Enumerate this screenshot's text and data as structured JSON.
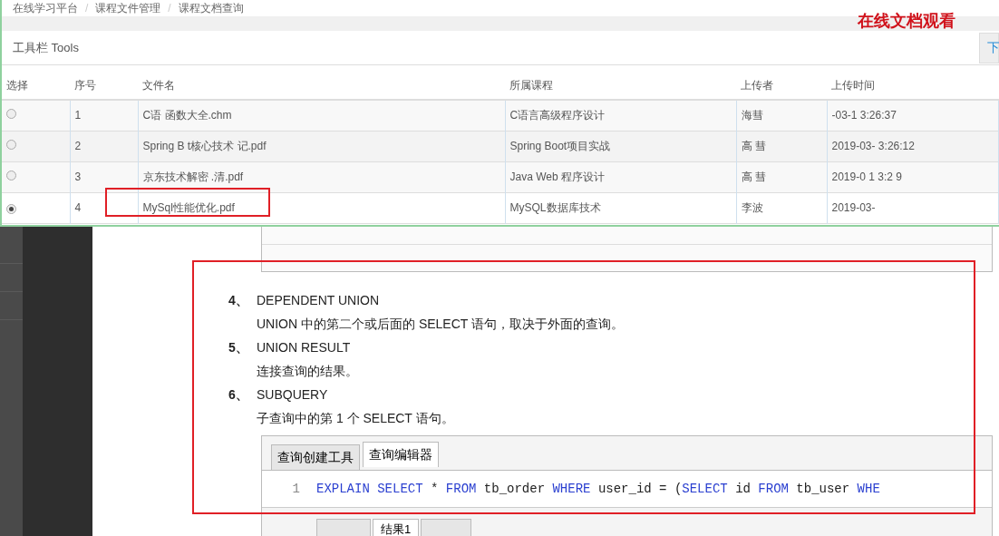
{
  "breadcrumb": {
    "separator": "/",
    "items": [
      "在线学习平台",
      "课程文件管理",
      "课程文档查询"
    ]
  },
  "annotation": "在线文档观看",
  "toolbar": {
    "title": "工具栏 Tools",
    "button": "下"
  },
  "table": {
    "columns": [
      "选择",
      "序号",
      "文件名",
      "所属课程",
      "上传者",
      "上传时间"
    ],
    "rows": [
      {
        "selected": false,
        "cells": [
          "",
          "1",
          "C语 函数大全.chm",
          "C语言高级程序设计",
          "海彗",
          "-03-1 3:26:37"
        ]
      },
      {
        "selected": false,
        "cells": [
          "",
          "2",
          "Spring B t核心技术 记.pdf",
          "Spring Boot项目实战",
          "高 彗",
          "2019-03- 3:26:12"
        ]
      },
      {
        "selected": false,
        "cells": [
          "",
          "3",
          "京东技术解密 .清.pdf",
          "Java Web 程序设计",
          "高 彗",
          "2019-0 1 3:2 9"
        ]
      },
      {
        "selected": true,
        "cells": [
          "",
          "4",
          "MySql性能优化.pdf",
          "MySQL数据库技术",
          "李波",
          "2019-03-"
        ]
      }
    ]
  },
  "document": {
    "items": [
      {
        "number": "4、",
        "title": "DEPENDENT UNION",
        "description": "UNION 中的第二个或后面的 SELECT 语句，取决于外面的查询。"
      },
      {
        "number": "5、",
        "title": "UNION RESULT",
        "description": "连接查询的结果。"
      },
      {
        "number": "6、",
        "title": "SUBQUERY",
        "description": "子查询中的第 1 个 SELECT 语句。"
      }
    ],
    "editor": {
      "tabs": [
        {
          "label": "查询创建工具",
          "selected": false
        },
        {
          "label": "查询编辑器",
          "selected": true
        }
      ],
      "line_number": "1",
      "code": [
        {
          "kind": "keyword",
          "text": "EXPLAIN SELECT"
        },
        {
          "kind": "plain",
          "text": " * "
        },
        {
          "kind": "keyword",
          "text": "FROM"
        },
        {
          "kind": "plain",
          "text": " tb_order "
        },
        {
          "kind": "keyword",
          "text": "WHERE"
        },
        {
          "kind": "plain",
          "text": " user_id = ("
        },
        {
          "kind": "keyword",
          "text": "SELECT"
        },
        {
          "kind": "plain",
          "text": " id "
        },
        {
          "kind": "keyword",
          "text": "FROM"
        },
        {
          "kind": "plain",
          "text": " tb_user "
        },
        {
          "kind": "keyword",
          "text": "WHE"
        }
      ],
      "result_tabs": [
        {
          "label": "结果1",
          "selected": true
        }
      ]
    }
  }
}
